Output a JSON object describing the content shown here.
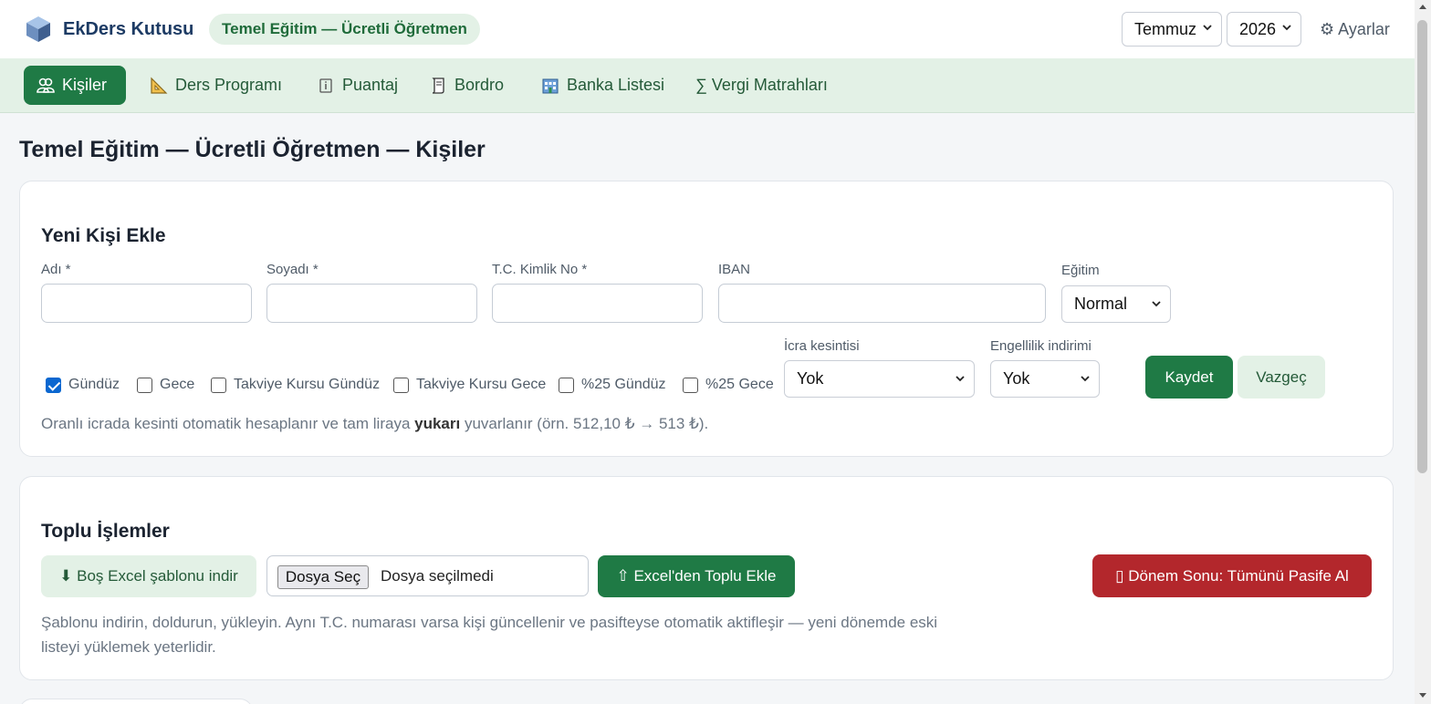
{
  "header": {
    "brand": "EkDers Kutusu",
    "context": "Temel Eğitim — Ücretli Öğretmen",
    "month": "Temmuz",
    "year": "2026",
    "settings": "⚙ Ayarlar"
  },
  "nav": {
    "items": [
      {
        "label": "Kişiler",
        "icon": "people-icon"
      },
      {
        "label": "Ders Programı",
        "icon": "ruler-icon"
      },
      {
        "label": "Puantaj",
        "icon": "info-icon"
      },
      {
        "label": "Bordro",
        "icon": "scroll-icon"
      },
      {
        "label": "Banka Listesi",
        "icon": "bank-icon"
      },
      {
        "label": "∑ Vergi Matrahları",
        "icon": "sigma-icon"
      }
    ],
    "active_index": 0
  },
  "page": {
    "title": "Temel Eğitim — Ücretli Öğretmen — Kişiler"
  },
  "new_person": {
    "title": "Yeni Kişi Ekle",
    "first_name_label": "Adı *",
    "last_name_label": "Soyadı *",
    "tc_label": "T.C. Kimlik No *",
    "iban_label": "IBAN",
    "education_label": "Eğitim",
    "education_value": "Normal",
    "checkboxes": [
      {
        "label": "Gündüz",
        "checked": true
      },
      {
        "label": "Gece",
        "checked": false
      },
      {
        "label": "Takviye Kursu Gündüz",
        "checked": false
      },
      {
        "label": "Takviye Kursu Gece",
        "checked": false
      },
      {
        "label": "%25 Gündüz",
        "checked": false
      },
      {
        "label": "%25 Gece",
        "checked": false
      }
    ],
    "garnishment_label": "İcra kesintisi",
    "garnishment_value": "Yok",
    "disability_label": "Engellilik indirimi",
    "disability_value": "Yok",
    "save": "Kaydet",
    "cancel": "Vazgeç",
    "hint_pre": "Oranlı icrada kesinti otomatik hesaplanır ve tam liraya ",
    "hint_bold": "yukarı",
    "hint_post": " yuvarlanır (örn. 512,10 ₺ → 513 ₺)."
  },
  "bulk": {
    "title": "Toplu İşlemler",
    "download_template": "⬇ Boş Excel şablonu indir",
    "file_button": "Dosya Seç",
    "file_status": "Dosya seçilmedi",
    "upload": "⇧ Excel'den Toplu Ekle",
    "deactivate": "▯ Dönem Sonu: Tümünü Pasife Al",
    "hint_line1": "Şablonu indirin, doldurun, yükleyin. Aynı T.C. numarası varsa kişi güncellenir ve pasifteyse otomatik aktifleşir — yeni dönemde eski",
    "hint_line2": "listeyi yüklemek yeterlidir."
  },
  "colors": {
    "primary": "#1f7a45",
    "soft": "#e3f1e6",
    "danger": "#b3272c",
    "brand": "#1d3b64"
  }
}
